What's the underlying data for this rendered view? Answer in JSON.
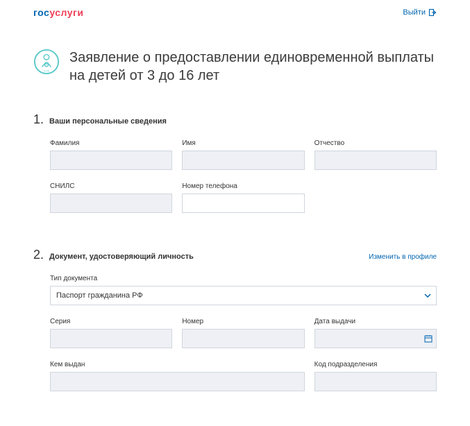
{
  "header": {
    "logo_part1": "гос",
    "logo_part2": "услуги",
    "logout_label": "Выйти"
  },
  "title": "Заявление о предоставлении единовременной выплаты на детей от 3 до 16 лет",
  "sections": {
    "personal": {
      "number": "1",
      "title": "Ваши персональные сведения",
      "fields": {
        "lastname_label": "Фамилия",
        "firstname_label": "Имя",
        "patronymic_label": "Отчество",
        "snils_label": "СНИЛС",
        "phone_label": "Номер телефона"
      }
    },
    "document": {
      "number": "2",
      "title": "Документ, удостоверяющий личность",
      "edit_link": "Изменить в профиле",
      "fields": {
        "doctype_label": "Тип документа",
        "doctype_value": "Паспорт гражданина РФ",
        "series_label": "Серия",
        "number_label": "Номер",
        "issue_date_label": "Дата выдачи",
        "issued_by_label": "Кем выдан",
        "dept_code_label": "Код подразделения"
      }
    }
  }
}
